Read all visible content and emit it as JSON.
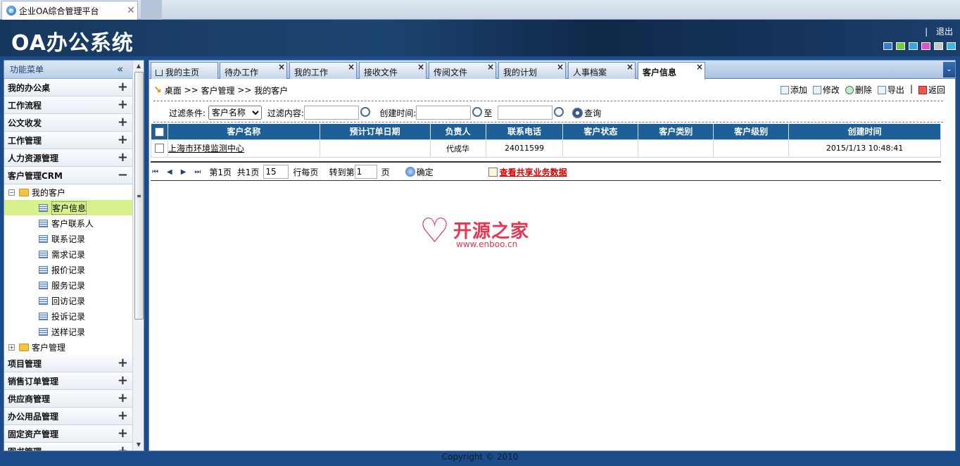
{
  "browser": {
    "tab_title": "企业OA综合管理平台",
    "close": "✕"
  },
  "header": {
    "logo": "OA办公系统",
    "separator": "|",
    "logout": "退出",
    "swatches": [
      "#2f7de0",
      "#6fcf3c",
      "#36a4e8",
      "#e04fd0",
      "#c8c8c8",
      "#3fb4e6"
    ]
  },
  "sidebar": {
    "title": "功能菜单",
    "collapse_icon": "«",
    "menus_top": [
      {
        "label": "我的办公桌",
        "sign": "+"
      },
      {
        "label": "工作流程",
        "sign": "+"
      },
      {
        "label": "公文收发",
        "sign": "+"
      },
      {
        "label": "工作管理",
        "sign": "+"
      },
      {
        "label": "人力资源管理",
        "sign": "+"
      },
      {
        "label": "客户管理CRM",
        "sign": "−"
      }
    ],
    "tree_folder": "我的客户",
    "tree_folder2": "客户管理",
    "leaves": [
      "客户信息",
      "客户联系人",
      "联系记录",
      "需求记录",
      "报价记录",
      "服务记录",
      "回访记录",
      "投诉记录",
      "送样记录"
    ],
    "menus_bottom": [
      {
        "label": "项目管理",
        "sign": "+"
      },
      {
        "label": "销售订单管理",
        "sign": "+"
      },
      {
        "label": "供应商管理",
        "sign": "+"
      },
      {
        "label": "办公用品管理",
        "sign": "+"
      },
      {
        "label": "固定资产管理",
        "sign": "+"
      },
      {
        "label": "图书管理",
        "sign": "+"
      }
    ]
  },
  "tabs": [
    {
      "label": "我的主页"
    },
    {
      "label": "待办工作"
    },
    {
      "label": "我的工作"
    },
    {
      "label": "接收文件"
    },
    {
      "label": "传阅文件"
    },
    {
      "label": "我的计划"
    },
    {
      "label": "人事档案"
    },
    {
      "label": "客户信息"
    }
  ],
  "breadcrumb": {
    "arrow": "↘",
    "items": [
      "桌面",
      ">>",
      "客户管理",
      ">>",
      "我的客户"
    ]
  },
  "toolbar": {
    "add": "添加",
    "edit": "修改",
    "delete": "删除",
    "export": "导出",
    "sep": "|",
    "back": "返回"
  },
  "filter": {
    "condition_label": "过滤条件:",
    "condition_value": "客户名称",
    "content_label": "过滤内容:",
    "created_label": "创建时间:",
    "to_label": "至",
    "search": "查询"
  },
  "table": {
    "headers": [
      "客户名称",
      "预计订单日期",
      "负责人",
      "联系电话",
      "客户状态",
      "客户类别",
      "客户级别",
      "创建时间"
    ],
    "rows": [
      [
        "上海市环境监测中心",
        "",
        "代成华",
        "24011599",
        "",
        "",
        "",
        "2015/1/13 10:48:41"
      ]
    ]
  },
  "pager": {
    "first": "⏮",
    "prev": "◀",
    "next": "▶",
    "last": "⏭",
    "page_info": "第1页",
    "total": "共1页",
    "per_page_value": "15",
    "per_page_label": "行每页",
    "goto_label": "转到第",
    "goto_value": "1",
    "page_unit": "页",
    "confirm": "确定",
    "share_link": "查看共享业务数据"
  },
  "watermark": {
    "brand": "开源之家",
    "url": "www.enboo.cn"
  },
  "footer": {
    "copyright": "Copyright © 2010"
  }
}
